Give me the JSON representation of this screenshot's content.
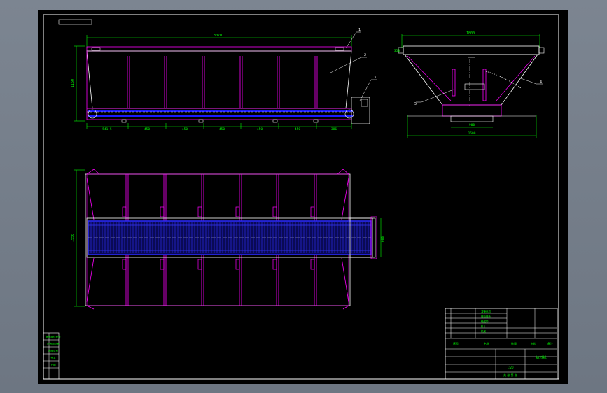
{
  "drawing": {
    "front_view": {
      "dimensions": {
        "overall_length": "3070",
        "height": "1150",
        "bays": [
          "541.5",
          "450",
          "450",
          "450",
          "450",
          "450",
          "386"
        ]
      },
      "balloons": [
        "1",
        "2",
        "3"
      ]
    },
    "side_view": {
      "dimensions": {
        "top_width": "1800",
        "left_offset": "350",
        "bottom_width": "900",
        "base_width": "1600"
      },
      "balloons": [
        "4",
        "5"
      ]
    },
    "plan_view": {
      "dimensions": {
        "width": "1550",
        "outlet": "600"
      }
    },
    "title_block": {
      "drawing_title": "给料机",
      "scale": "1:20",
      "sheet": "共 张 第 张",
      "headers": [
        "序号",
        "名称",
        "数量",
        "材料",
        "备注"
      ],
      "rows": [
        "减速电机",
        "链轮链条",
        "输送带",
        "料斗",
        "机架"
      ]
    },
    "revision_panel": [
      "借通用件登记",
      "旧底图总号",
      "底图总号",
      "签字",
      "日期"
    ]
  },
  "colors": {
    "background": "#000000",
    "outline": "#ffffff",
    "structure": "#ff00ff",
    "conveyor": "#2a2aff",
    "dimension": "#00ff00",
    "leader": "#ffffff"
  }
}
